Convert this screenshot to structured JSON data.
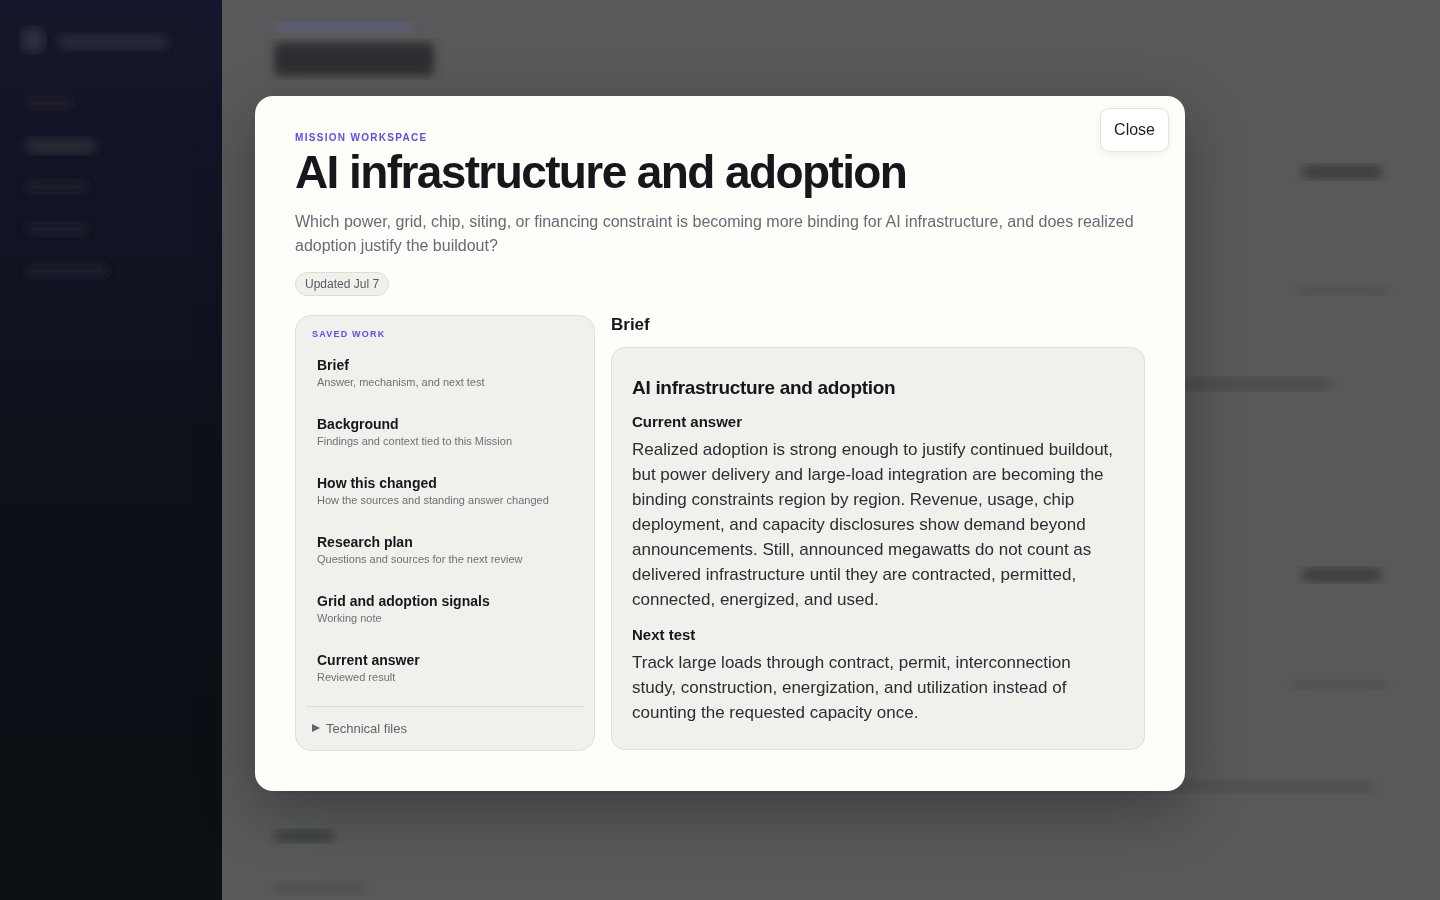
{
  "modal": {
    "eyebrow": "MISSION WORKSPACE",
    "title": "AI infrastructure and adoption",
    "description": "Which power, grid, chip, siting, or financing constraint is becoming more binding for AI infrastructure, and does realized adoption justify the buildout?",
    "badge": "Updated Jul 7",
    "close_button": "Close"
  },
  "saved_work": {
    "heading": "SAVED WORK",
    "items": [
      {
        "title": "Brief",
        "subtitle": "Answer, mechanism, and next test"
      },
      {
        "title": "Background",
        "subtitle": "Findings and context tied to this Mission"
      },
      {
        "title": "How this changed",
        "subtitle": "How the sources and standing answer changed"
      },
      {
        "title": "Research plan",
        "subtitle": "Questions and sources for the next review"
      },
      {
        "title": "Grid and adoption signals",
        "subtitle": "Working note"
      },
      {
        "title": "Current answer",
        "subtitle": "Reviewed result"
      }
    ],
    "technical_files": {
      "label": "Technical files",
      "expanded": false
    }
  },
  "brief": {
    "heading": "Brief",
    "card_title": "AI infrastructure and adoption",
    "sections": [
      {
        "heading": "Current answer",
        "body": "Realized adoption is strong enough to justify continued buildout, but power delivery and large-load integration are becoming the binding constraints region by region. Revenue, usage, chip deployment, and capacity disclosures show demand beyond announcements. Still, announced megawatts do not count as delivered infrastructure until they are contracted, permitted, connected, energized, and used."
      },
      {
        "heading": "Next test",
        "body": "Track large loads through contract, permit, interconnection study, construction, energization, and utilization instead of counting the requested capacity once."
      }
    ]
  }
}
